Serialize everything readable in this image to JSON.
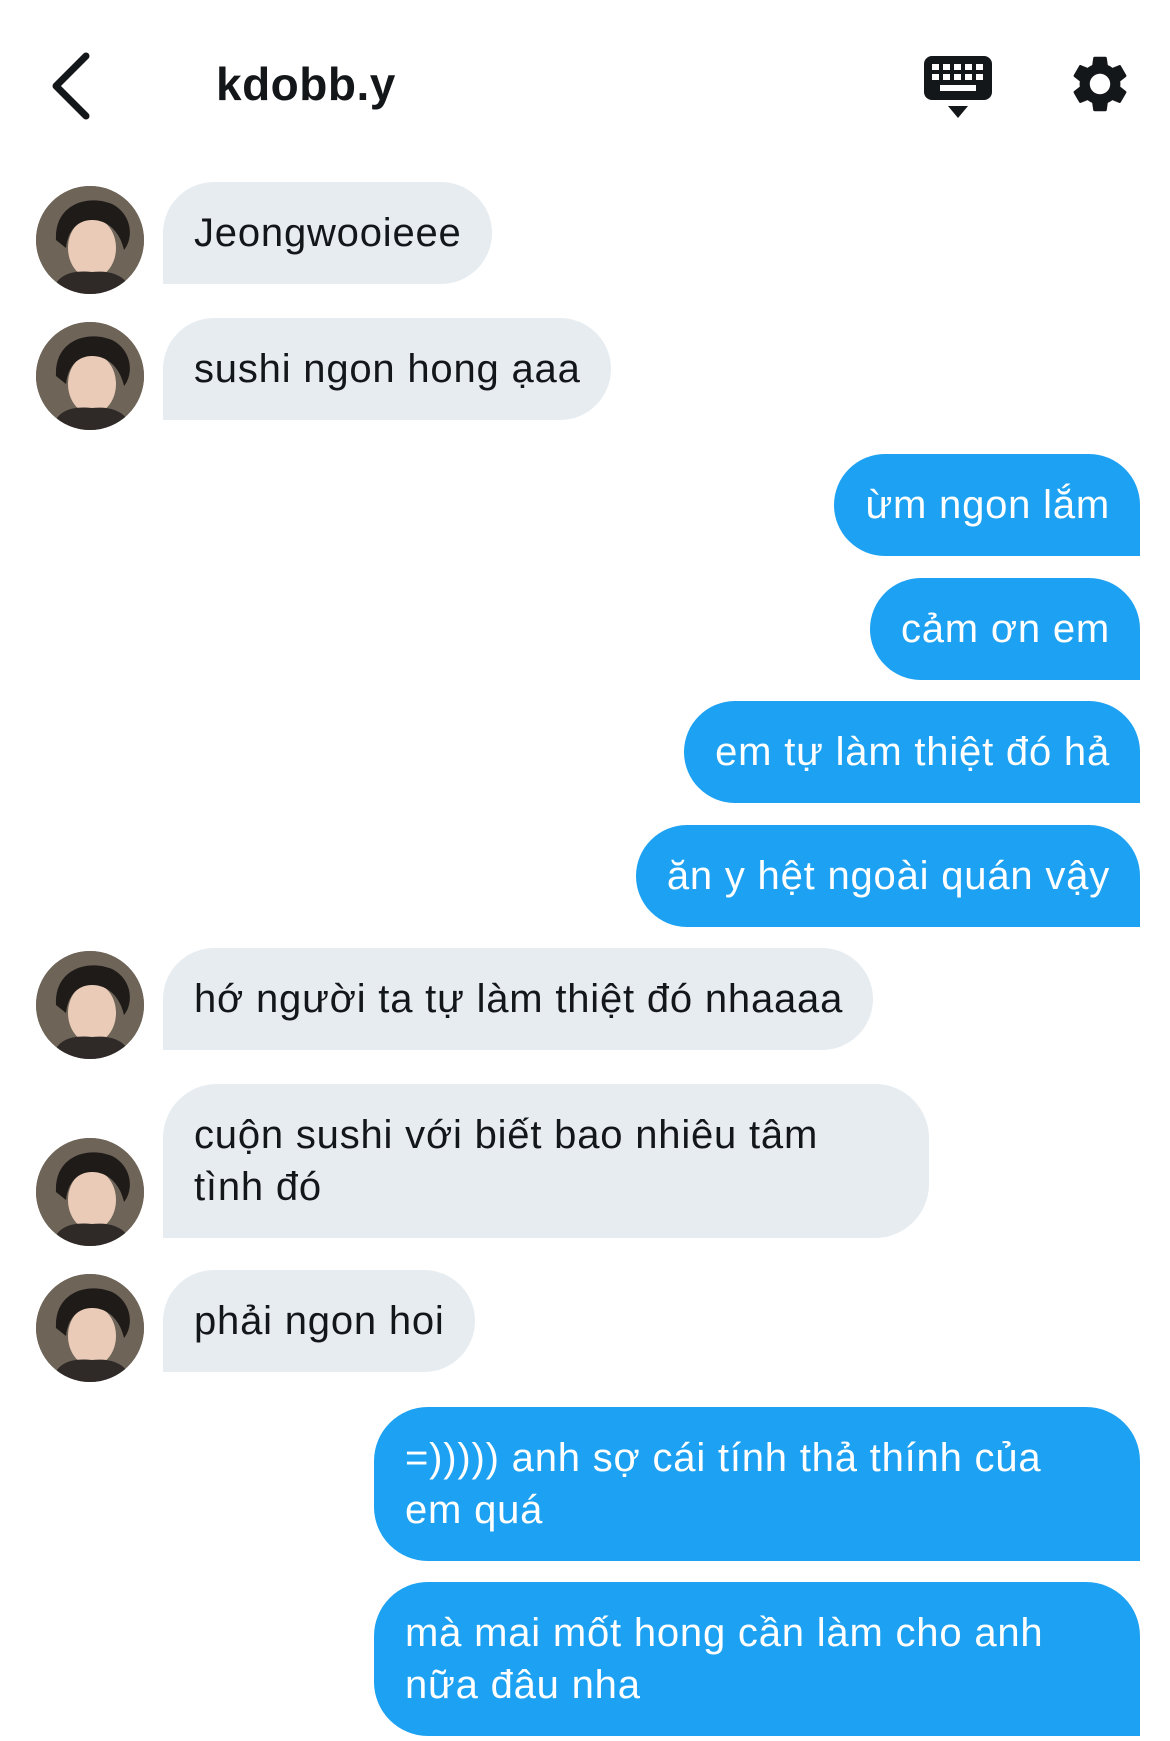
{
  "header": {
    "title": "kdobb.y",
    "back_icon": "chevron-left-icon",
    "keyboard_icon": "keyboard-icon",
    "settings_icon": "gear-icon"
  },
  "colors": {
    "incoming_bubble": "#e6ecf0",
    "outgoing_bubble": "#1da1f2",
    "text": "#14171a"
  },
  "messages": [
    {
      "from": "them",
      "text": "Jeongwooieee"
    },
    {
      "from": "them",
      "text": "sushi ngon hong ạaa"
    },
    {
      "from": "me",
      "text": "ừm ngon lắm"
    },
    {
      "from": "me",
      "text": "cảm ơn em"
    },
    {
      "from": "me",
      "text": "em tự làm thiệt đó hả"
    },
    {
      "from": "me",
      "text": "ăn y hệt ngoài quán vậy"
    },
    {
      "from": "them",
      "text": "hớ người ta tự làm thiệt đó nhaaaa"
    },
    {
      "from": "them",
      "text": "cuộn sushi với biết bao nhiêu tâm tình đó"
    },
    {
      "from": "them",
      "text": "phải ngon hoi"
    },
    {
      "from": "me",
      "text": "=))))) anh sợ cái tính thả thính của em quá"
    },
    {
      "from": "me",
      "text": "mà mai mốt hong cần làm cho anh nữa đâu nha"
    }
  ]
}
